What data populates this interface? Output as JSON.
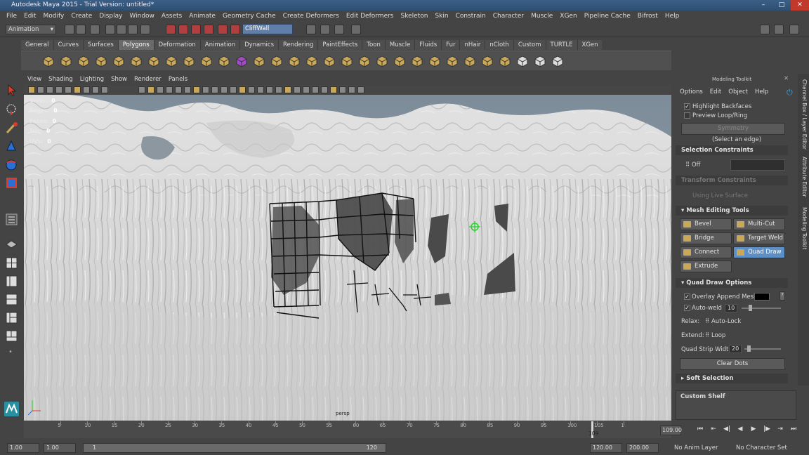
{
  "app": {
    "title": "Autodesk Maya 2015 - Trial Version: untitled*"
  },
  "menu": [
    "File",
    "Edit",
    "Modify",
    "Create",
    "Display",
    "Window",
    "Assets",
    "Animate",
    "Geometry Cache",
    "Create Deformers",
    "Edit Deformers",
    "Skeleton",
    "Skin",
    "Constrain",
    "Character",
    "Muscle",
    "XGen",
    "Pipeline Cache",
    "Bifrost",
    "Help"
  ],
  "status_line": {
    "mode": "Animation",
    "object_field": "CliffWall"
  },
  "shelf": {
    "tabs": [
      "General",
      "Curves",
      "Surfaces",
      "Polygons",
      "Deformation",
      "Animation",
      "Dynamics",
      "Rendering",
      "PaintEffects",
      "Toon",
      "Muscle",
      "Fluids",
      "Fur",
      "nHair",
      "nCloth",
      "Custom",
      "TURTLE",
      "XGen"
    ],
    "selected": "Polygons"
  },
  "viewport": {
    "menu": [
      "View",
      "Shading",
      "Lighting",
      "Show",
      "Renderer",
      "Panels"
    ],
    "hud": [
      "Verts:",
      "Edges:",
      "Faces:",
      "Tris:",
      "UVs:"
    ],
    "hud_values": [
      "0",
      "0",
      "0",
      "0",
      "0"
    ],
    "camera_label": "persp"
  },
  "toolkit": {
    "title": "Modeling Toolkit",
    "menu": [
      "Options",
      "Edit",
      "Object",
      "Help"
    ],
    "highlight_backfaces": "Highlight Backfaces",
    "preview_loop": "Preview Loop/Ring",
    "symmetry_button": "Symmetry",
    "select_hint": "(Select an edge)",
    "selection_constraints": "Selection Constraints",
    "constraint_value": "Off",
    "transform_constraints": "Transform Constraints",
    "using_live_surface": "Using Live Surface",
    "mesh_editing_tools": "Mesh Editing Tools",
    "tools": {
      "bevel": "Bevel",
      "multi_cut": "Multi-Cut",
      "bridge": "Bridge",
      "target_weld": "Target Weld",
      "connect": "Connect",
      "quad_draw": "Quad Draw",
      "extrude": "Extrude"
    },
    "quad_draw_options": "Quad Draw Options",
    "overlay_append": "Overlay Append Mesh",
    "auto_weld": "Auto-weld",
    "auto_weld_value": "10",
    "relax_label": "Relax:",
    "relax_value": "Auto-Lock",
    "extend_label": "Extend:",
    "extend_value": "Loop",
    "strip_width_label": "Quad Strip Width:",
    "strip_width_value": "20",
    "clear_dots": "Clear Dots",
    "soft_selection": "Soft Selection",
    "custom_shelf": "Custom Shelf"
  },
  "side_tabs": [
    "Channel Box / Layer Editor",
    "Attribute Editor",
    "Modeling Toolkit"
  ],
  "timeline": {
    "ticks": [
      "5",
      "10",
      "15",
      "20",
      "25",
      "30",
      "35",
      "40",
      "45",
      "50",
      "55",
      "60",
      "65",
      "70",
      "75",
      "80",
      "85",
      "90",
      "95",
      "100",
      "105",
      "1"
    ],
    "current_frame": "109",
    "current_time": "109.00"
  },
  "range": {
    "start": "1.00",
    "start2": "1.00",
    "slider_start": "1",
    "slider_end": "120",
    "end": "120.00",
    "end2": "200.00",
    "anim_layer": "No Anim Layer",
    "char_set": "No Character Set"
  },
  "colors": {
    "accent": "#5b8fc6",
    "title": "#3a5f86"
  }
}
